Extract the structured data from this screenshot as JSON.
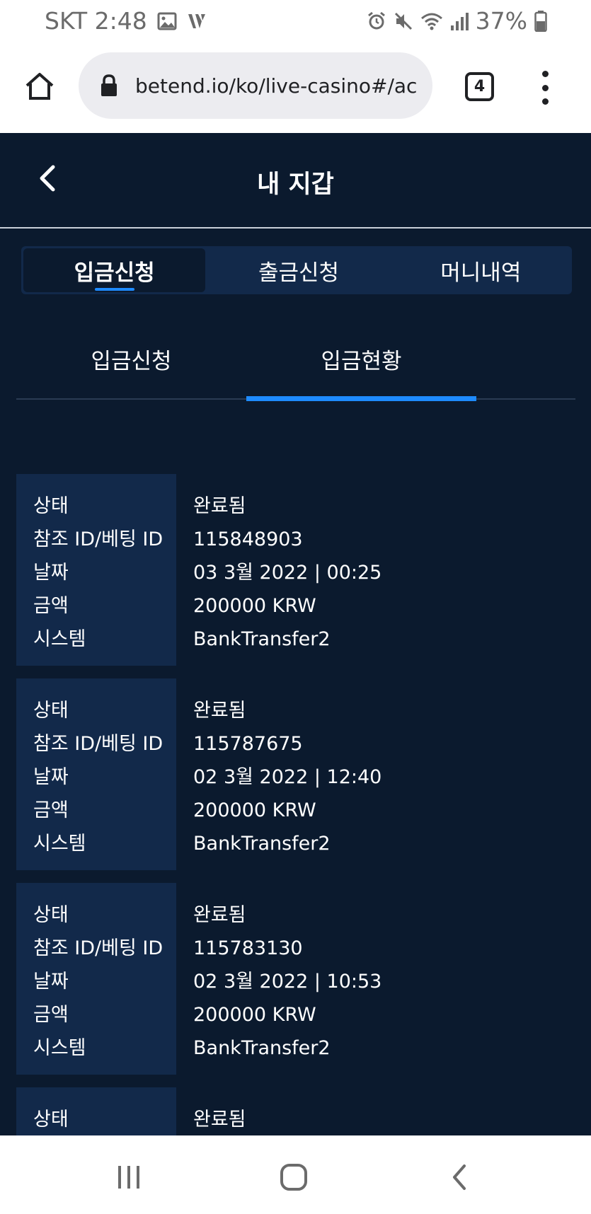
{
  "status_bar": {
    "carrier_time": "SKT 2:48",
    "battery": "37%"
  },
  "browser": {
    "url": "betend.io/ko/live-casino#/acco",
    "tab_count": "4"
  },
  "header": {
    "title": "내 지갑"
  },
  "main_tabs": [
    {
      "label": "입금신청",
      "active": true
    },
    {
      "label": "출금신청",
      "active": false
    },
    {
      "label": "머니내역",
      "active": false
    }
  ],
  "sub_tabs": [
    {
      "label": "입금신청",
      "active": false
    },
    {
      "label": "입금현황",
      "active": true
    }
  ],
  "labels": {
    "status": "상태",
    "ref_id": "참조 ID/베팅 ID",
    "date": "날짜",
    "amount": "금액",
    "system": "시스템"
  },
  "records": [
    {
      "status": "완료됨",
      "ref_id": "115848903",
      "date": "03 3월 2022 | 00:25",
      "amount": "200000 KRW",
      "system": "BankTransfer2"
    },
    {
      "status": "완료됨",
      "ref_id": "115787675",
      "date": "02 3월 2022 | 12:40",
      "amount": "200000 KRW",
      "system": "BankTransfer2"
    },
    {
      "status": "완료됨",
      "ref_id": "115783130",
      "date": "02 3월 2022 | 10:53",
      "amount": "200000 KRW",
      "system": "BankTransfer2"
    },
    {
      "status": "완료됨"
    }
  ],
  "colors": {
    "app_bg": "#0b1a2e",
    "panel_bg": "#12294a",
    "accent": "#1e8bff"
  },
  "icons": {
    "status_left": [
      "gallery-icon",
      "v-app-icon"
    ],
    "status_right": [
      "alarm-icon",
      "mute-icon",
      "wifi-icon",
      "signal-icon",
      "battery-icon"
    ],
    "browser": [
      "home-icon",
      "lock-icon",
      "tabs-icon",
      "more-vert-icon"
    ],
    "app": [
      "back-arrow-icon"
    ],
    "nav": [
      "recents-icon",
      "home-nav-icon",
      "back-nav-icon"
    ]
  }
}
